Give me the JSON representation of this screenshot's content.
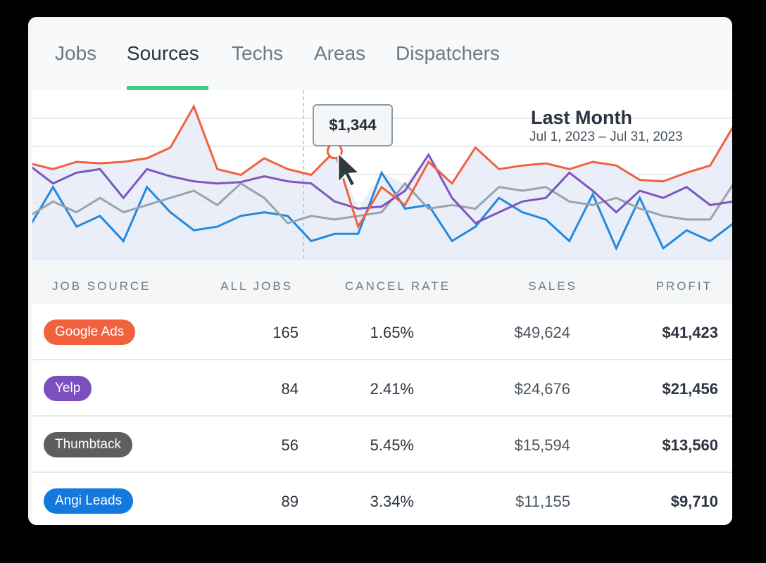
{
  "tabs": [
    {
      "label": "Jobs"
    },
    {
      "label": "Sources"
    },
    {
      "label": "Techs"
    },
    {
      "label": "Areas"
    },
    {
      "label": "Dispatchers"
    }
  ],
  "active_tab": "Sources",
  "tooltip": {
    "value": "$1,344"
  },
  "period": {
    "title": "Last Month",
    "range": "Jul 1, 2023 – Jul 31, 2023"
  },
  "table": {
    "headers": [
      "JOB SOURCE",
      "ALL JOBS",
      "CANCEL RATE",
      "SALES",
      "PROFIT"
    ],
    "rows": [
      {
        "source": "Google Ads",
        "color": "#f2613d",
        "jobs": "165",
        "cancel_rate": "1.65%",
        "sales": "$49,624",
        "profit": "$41,423"
      },
      {
        "source": "Yelp",
        "color": "#7b4fbf",
        "jobs": "84",
        "cancel_rate": "2.41%",
        "sales": "$24,676",
        "profit": "$21,456"
      },
      {
        "source": "Thumbtack",
        "color": "#5e5e5e",
        "jobs": "56",
        "cancel_rate": "5.45%",
        "sales": "$15,594",
        "profit": "$13,560"
      },
      {
        "source": "Angi Leads",
        "color": "#1479de",
        "jobs": "89",
        "cancel_rate": "3.34%",
        "sales": "$11,155",
        "profit": "$9,710"
      }
    ]
  },
  "chart_data": {
    "type": "line",
    "ylim": [
      0,
      220
    ],
    "series": [
      {
        "name": "Google Ads",
        "color": "#f0623f",
        "values": [
          128,
          120,
          130,
          128,
          130,
          135,
          150,
          207,
          120,
          112,
          135,
          120,
          112,
          145,
          40,
          95,
          70,
          130,
          100,
          150,
          120,
          125,
          128,
          120,
          130,
          125,
          105,
          103,
          115,
          125,
          180
        ]
      },
      {
        "name": "Yelp",
        "color": "#7d55c0",
        "values": [
          125,
          100,
          115,
          120,
          80,
          120,
          110,
          103,
          100,
          102,
          110,
          103,
          100,
          75,
          65,
          68,
          90,
          140,
          80,
          45,
          60,
          75,
          80,
          115,
          90,
          60,
          90,
          80,
          95,
          70,
          75
        ]
      },
      {
        "name": "Thumbtack",
        "color": "#9aa3ad",
        "values": [
          55,
          75,
          60,
          80,
          60,
          70,
          80,
          90,
          70,
          100,
          80,
          45,
          55,
          50,
          55,
          60,
          100,
          65,
          70,
          65,
          95,
          90,
          95,
          75,
          70,
          80,
          65,
          55,
          50,
          50,
          100
        ]
      },
      {
        "name": "Angi Leads",
        "color": "#2489dc",
        "values": [
          40,
          95,
          40,
          55,
          20,
          95,
          60,
          35,
          40,
          55,
          60,
          55,
          20,
          30,
          30,
          115,
          65,
          70,
          20,
          40,
          80,
          60,
          50,
          20,
          85,
          10,
          80,
          10,
          35,
          20,
          45
        ]
      }
    ]
  }
}
